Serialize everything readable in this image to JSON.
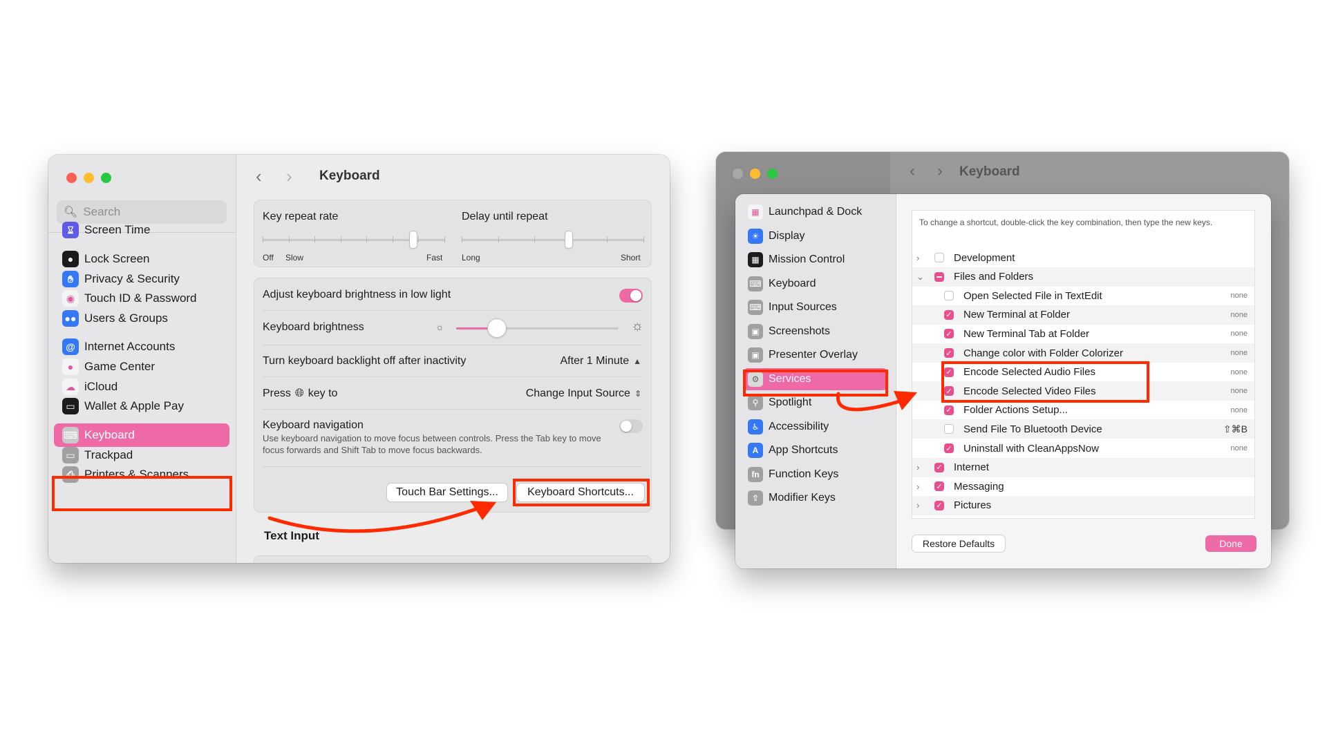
{
  "left_window": {
    "title": "Keyboard",
    "search_placeholder": "Search",
    "sidebar_items": [
      {
        "label": "Screen Time",
        "icon": "hourglass-icon",
        "color": "#5e5ce6"
      },
      {
        "label": "Lock Screen",
        "icon": "lock-icon",
        "color": "#1c1c1e"
      },
      {
        "label": "Privacy & Security",
        "icon": "hand-icon",
        "color": "#3478f6"
      },
      {
        "label": "Touch ID & Password",
        "icon": "fingerprint-icon",
        "color": "#f4f4f4"
      },
      {
        "label": "Users & Groups",
        "icon": "users-icon",
        "color": "#3478f6"
      },
      {
        "label": "Internet Accounts",
        "icon": "at-icon",
        "color": "#3478f6"
      },
      {
        "label": "Game Center",
        "icon": "game-center-icon",
        "color": "#f4f4f4"
      },
      {
        "label": "iCloud",
        "icon": "cloud-icon",
        "color": "#f4f4f4"
      },
      {
        "label": "Wallet & Apple Pay",
        "icon": "wallet-icon",
        "color": "#1c1c1e"
      },
      {
        "label": "Keyboard",
        "icon": "keyboard-icon",
        "color": "#a0a0a0",
        "selected": true
      },
      {
        "label": "Trackpad",
        "icon": "trackpad-icon",
        "color": "#a0a0a0"
      },
      {
        "label": "Printers & Scanners",
        "icon": "printer-icon",
        "color": "#a0a0a0"
      }
    ],
    "key_repeat_rate": {
      "label": "Key repeat rate",
      "min_labels": [
        "Off",
        "Slow"
      ],
      "max_label": "Fast"
    },
    "delay_until_repeat": {
      "label": "Delay until repeat",
      "min_label": "Long",
      "max_label": "Short"
    },
    "adjust_brightness": {
      "label": "Adjust keyboard brightness in low light",
      "on": true
    },
    "keyboard_brightness": {
      "label": "Keyboard brightness",
      "level": 0.25
    },
    "backlight_off": {
      "label": "Turn keyboard backlight off after inactivity",
      "value": "After 1 Minute"
    },
    "press_key": {
      "label_prefix": "Press",
      "label_suffix": "key to",
      "value": "Change Input Source"
    },
    "keyboard_navigation": {
      "label": "Keyboard navigation",
      "description": "Use keyboard navigation to move focus between controls. Press the Tab key to move focus forwards and Shift Tab to move focus backwards.",
      "on": false
    },
    "buttons": {
      "touch_bar": "Touch Bar Settings...",
      "shortcuts": "Keyboard Shortcuts..."
    },
    "section_text_input": "Text Input"
  },
  "right_window": {
    "title": "Keyboard",
    "sidebar_items": [
      {
        "label": "Launchpad & Dock",
        "icon": "launchpad-icon",
        "color": "#f4f4f4"
      },
      {
        "label": "Display",
        "icon": "display-icon",
        "color": "#3478f6"
      },
      {
        "label": "Mission Control",
        "icon": "mission-control-icon",
        "color": "#1c1c1e"
      },
      {
        "label": "Keyboard",
        "icon": "keyboard-icon",
        "color": "#a0a0a0"
      },
      {
        "label": "Input Sources",
        "icon": "input-sources-icon",
        "color": "#a0a0a0"
      },
      {
        "label": "Screenshots",
        "icon": "screenshot-icon",
        "color": "#a0a0a0"
      },
      {
        "label": "Presenter Overlay",
        "icon": "presenter-icon",
        "color": "#a0a0a0"
      },
      {
        "label": "Services",
        "icon": "gears-icon",
        "color": "#a0a0a0",
        "selected": true
      },
      {
        "label": "Spotlight",
        "icon": "spotlight-icon",
        "color": "#a0a0a0"
      },
      {
        "label": "Accessibility",
        "icon": "accessibility-icon",
        "color": "#3478f6"
      },
      {
        "label": "App Shortcuts",
        "icon": "app-store-icon",
        "color": "#3478f6"
      },
      {
        "label": "Function Keys",
        "icon": "fn-icon",
        "color": "#a0a0a0"
      },
      {
        "label": "Modifier Keys",
        "icon": "modifier-icon",
        "color": "#a0a0a0"
      }
    ],
    "hint": "To change a shortcut, double-click the key combination, then type the new keys.",
    "rows": [
      {
        "level": 0,
        "chevron": "›",
        "check": "off",
        "label": "Development",
        "shortcut": ""
      },
      {
        "level": 0,
        "chevron": "⌄",
        "check": "mixed",
        "label": "Files and Folders",
        "shortcut": ""
      },
      {
        "level": 1,
        "chevron": "",
        "check": "off",
        "label": "Open Selected File in TextEdit",
        "shortcut": "none"
      },
      {
        "level": 1,
        "chevron": "",
        "check": "on",
        "label": "New Terminal at Folder",
        "shortcut": "none"
      },
      {
        "level": 1,
        "chevron": "",
        "check": "on",
        "label": "New Terminal Tab at Folder",
        "shortcut": "none"
      },
      {
        "level": 1,
        "chevron": "",
        "check": "on",
        "label": "Change color with Folder Colorizer",
        "shortcut": "none"
      },
      {
        "level": 1,
        "chevron": "",
        "check": "on",
        "label": "Encode Selected Audio Files",
        "shortcut": "none"
      },
      {
        "level": 1,
        "chevron": "",
        "check": "on",
        "label": "Encode Selected Video Files",
        "shortcut": "none"
      },
      {
        "level": 1,
        "chevron": "",
        "check": "on",
        "label": "Folder Actions Setup...",
        "shortcut": "none"
      },
      {
        "level": 1,
        "chevron": "",
        "check": "off",
        "label": "Send File To Bluetooth Device",
        "shortcut": "⇧⌘B"
      },
      {
        "level": 1,
        "chevron": "",
        "check": "on",
        "label": "Uninstall with CleanAppsNow",
        "shortcut": "none"
      },
      {
        "level": 0,
        "chevron": "›",
        "check": "on",
        "label": "Internet",
        "shortcut": ""
      },
      {
        "level": 0,
        "chevron": "›",
        "check": "on",
        "label": "Messaging",
        "shortcut": ""
      },
      {
        "level": 0,
        "chevron": "›",
        "check": "on",
        "label": "Pictures",
        "shortcut": ""
      }
    ],
    "buttons": {
      "restore": "Restore Defaults",
      "done": "Done"
    }
  },
  "colors": {
    "accent": "#ee6aa6",
    "highlight": "#ff2a00"
  }
}
